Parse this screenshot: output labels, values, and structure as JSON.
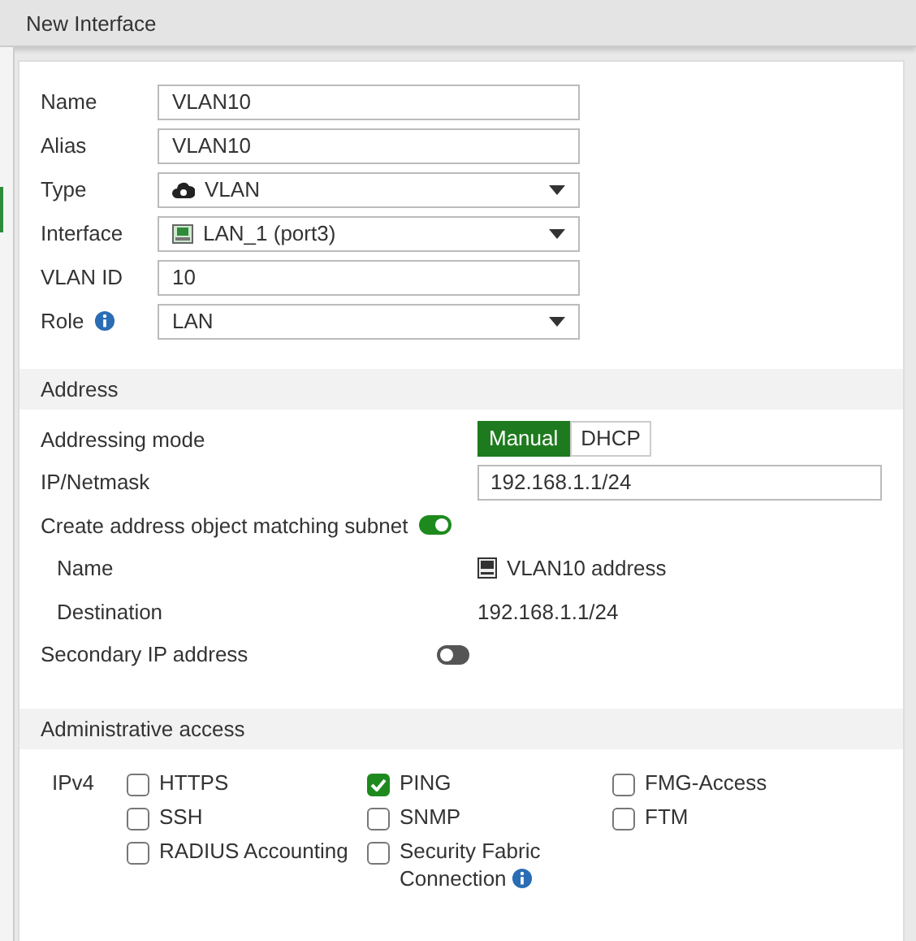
{
  "window": {
    "title": "New Interface"
  },
  "fields": [
    {
      "label": "Name",
      "kind": "text",
      "value": "VLAN10",
      "info": false
    },
    {
      "label": "Alias",
      "kind": "text",
      "value": "VLAN10",
      "info": false
    },
    {
      "label": "Type",
      "kind": "type-select",
      "value": "VLAN",
      "info": false
    },
    {
      "label": "Interface",
      "kind": "port-select",
      "value": "LAN_1 (port3)",
      "info": false
    },
    {
      "label": "VLAN ID",
      "kind": "text",
      "value": "10",
      "info": false
    },
    {
      "label": "Role",
      "kind": "select",
      "value": "LAN",
      "info": true
    }
  ],
  "address": {
    "title": "Address",
    "addressing_mode": {
      "label": "Addressing mode",
      "options": [
        {
          "label": "Manual",
          "selected": true
        },
        {
          "label": "DHCP",
          "selected": false
        }
      ]
    },
    "ip_netmask": {
      "label": "IP/Netmask",
      "value": "192.168.1.1/24"
    },
    "create_object": {
      "label": "Create address object matching subnet",
      "on": true
    },
    "object_name": {
      "label": "Name",
      "value": "VLAN10 address"
    },
    "destination": {
      "label": "Destination",
      "value": "192.168.1.1/24"
    },
    "secondary_ip": {
      "label": "Secondary IP address",
      "on": false
    }
  },
  "admin_access": {
    "title": "Administrative access",
    "protocol_label": "IPv4",
    "options": [
      {
        "label": "HTTPS",
        "checked": false,
        "info": false
      },
      {
        "label": "PING",
        "checked": true,
        "info": false
      },
      {
        "label": "FMG-Access",
        "checked": false,
        "info": false
      },
      {
        "label": "SSH",
        "checked": false,
        "info": false
      },
      {
        "label": "SNMP",
        "checked": false,
        "info": false
      },
      {
        "label": "FTM",
        "checked": false,
        "info": false
      },
      {
        "label": "RADIUS Accounting",
        "checked": false,
        "info": false
      },
      {
        "label": "Security Fabric Connection",
        "checked": false,
        "info": true
      }
    ]
  }
}
